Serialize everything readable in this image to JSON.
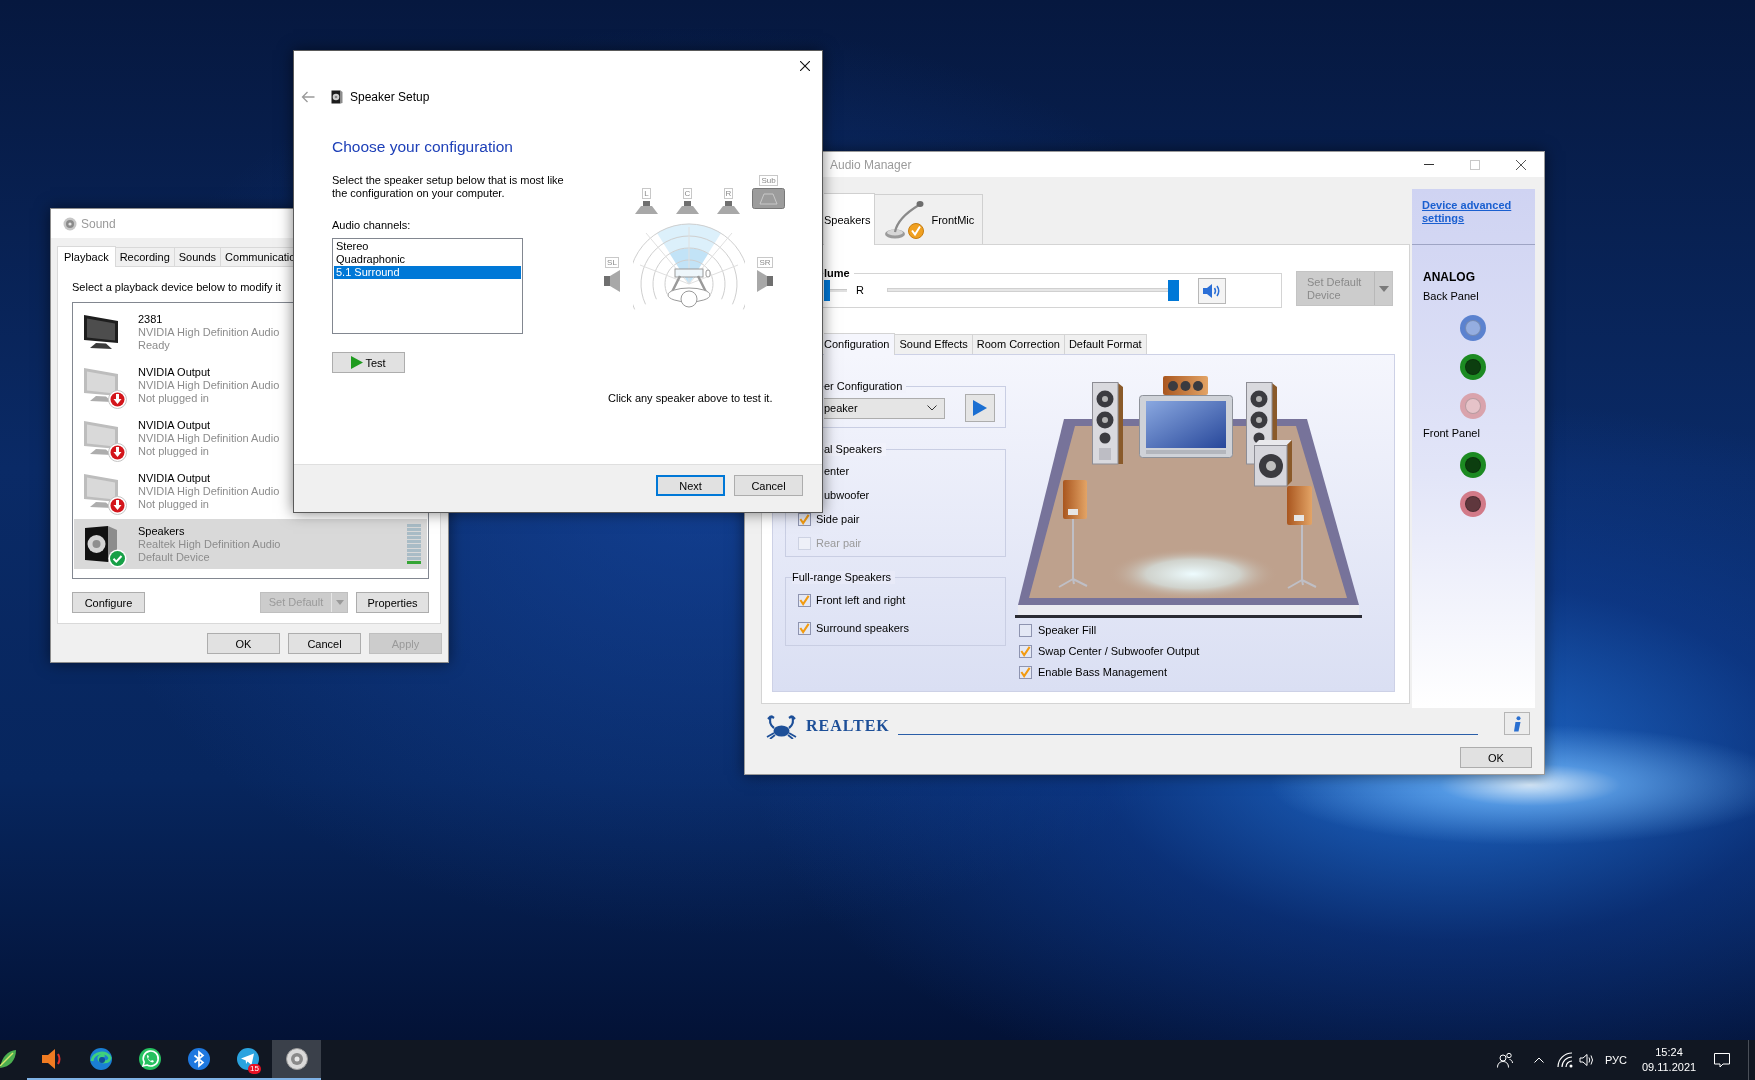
{
  "sound_window": {
    "title": "Sound",
    "tabs": [
      {
        "label": "Playback",
        "selected": true
      },
      {
        "label": "Recording",
        "selected": false
      },
      {
        "label": "Sounds",
        "selected": false
      },
      {
        "label": "Communicatio",
        "selected": false
      }
    ],
    "instruction": "Select a playback device below to modify it",
    "devices": [
      {
        "kind": "monitor",
        "name": "2381",
        "driver": "NVIDIA High Definition Audio",
        "status": "Ready",
        "unplugged": false,
        "default": false,
        "selected": false
      },
      {
        "kind": "monitor",
        "name": "NVIDIA Output",
        "driver": "NVIDIA High Definition Audio",
        "status": "Not plugged in",
        "unplugged": true,
        "default": false,
        "selected": false
      },
      {
        "kind": "monitor",
        "name": "NVIDIA Output",
        "driver": "NVIDIA High Definition Audio",
        "status": "Not plugged in",
        "unplugged": true,
        "default": false,
        "selected": false
      },
      {
        "kind": "monitor",
        "name": "NVIDIA Output",
        "driver": "NVIDIA High Definition Audio",
        "status": "Not plugged in",
        "unplugged": true,
        "default": false,
        "selected": false
      },
      {
        "kind": "speaker",
        "name": "Speakers",
        "driver": "Realtek High Definition Audio",
        "status": "Default Device",
        "unplugged": false,
        "default": true,
        "selected": true,
        "level": 0.1
      }
    ],
    "device_buttons": {
      "configure": {
        "label": "Configure",
        "disabled": false
      },
      "set_default": {
        "label": "Set Default",
        "disabled": true
      },
      "properties": {
        "label": "Properties",
        "disabled": false
      }
    },
    "footer_buttons": {
      "ok": {
        "label": "OK",
        "disabled": false
      },
      "cancel": {
        "label": "Cancel",
        "disabled": false
      },
      "apply": {
        "label": "Apply",
        "disabled": true
      }
    }
  },
  "speaker_setup": {
    "title": "Speaker Setup",
    "heading": "Choose your configuration",
    "description": "Select the speaker setup below that is most like the configuration on your computer.",
    "channels_label": "Audio channels:",
    "channels": [
      {
        "label": "Stereo",
        "selected": false
      },
      {
        "label": "Quadraphonic",
        "selected": false
      },
      {
        "label": "5.1 Surround",
        "selected": true
      }
    ],
    "test_button": "Test",
    "speakers": [
      {
        "kind": "left",
        "label": "L"
      },
      {
        "kind": "center",
        "label": "C"
      },
      {
        "kind": "right",
        "label": "R"
      },
      {
        "kind": "sub",
        "label": "Sub"
      },
      {
        "kind": "surround_left",
        "label": "SL"
      },
      {
        "kind": "surround_right",
        "label": "SR"
      }
    ],
    "hint": "Click any speaker above to test it.",
    "next_button": {
      "label": "Next",
      "default": true
    },
    "cancel_button": {
      "label": "Cancel",
      "default": false
    }
  },
  "audio_manager": {
    "title": "Audio Manager",
    "device_tabs": [
      {
        "kind": "speaker",
        "label": "Speakers",
        "selected": true
      },
      {
        "kind": "mic",
        "label": "FrontMic",
        "selected": false
      }
    ],
    "volume": {
      "label": "lume",
      "balance": {
        "label": "R",
        "level": 0
      },
      "main": {
        "level": 1
      }
    },
    "set_default_button": {
      "label": "Set Default Device",
      "disabled": true
    },
    "sub_tabs": [
      {
        "label": "Configuration",
        "selected": true
      },
      {
        "label": "Sound Effects",
        "selected": false
      },
      {
        "label": "Room Correction",
        "selected": false
      },
      {
        "label": "Default Format",
        "selected": false
      }
    ],
    "config_group": {
      "label": "er Configuration",
      "value": "peaker"
    },
    "optional_group": {
      "label": "al Speakers",
      "items": [
        {
          "kind": "cut",
          "label": "enter",
          "disabled": false
        },
        {
          "kind": "cut",
          "label": "ubwoofer",
          "disabled": false
        },
        {
          "kind": "checkbox",
          "label": "Side pair",
          "checked": true,
          "disabled": false
        },
        {
          "kind": "checkbox",
          "label": "Rear pair",
          "checked": false,
          "disabled": true
        }
      ]
    },
    "fullrange_group": {
      "label": "Full-range Speakers",
      "items": [
        {
          "label": "Front left and right",
          "checked": true
        },
        {
          "label": "Surround speakers",
          "checked": true
        }
      ]
    },
    "options": [
      {
        "label": "Speaker Fill",
        "checked": false
      },
      {
        "label": "Swap Center / Subwoofer Output",
        "checked": true
      },
      {
        "label": "Enable Bass Management",
        "checked": true
      }
    ],
    "sidebar": {
      "link": "Device advanced settings",
      "heading": "ANALOG",
      "panels": [
        {
          "label": "Back Panel",
          "jacks": [
            {
              "color": "#5b82cf",
              "plugged": false
            },
            {
              "color": "#1c8a22",
              "plugged": true
            },
            {
              "color": "#d9a3ac",
              "plugged": false
            }
          ]
        },
        {
          "label": "Front Panel",
          "jacks": [
            {
              "color": "#1c8a22",
              "plugged": true
            },
            {
              "color": "#d27a88",
              "plugged": true
            }
          ]
        }
      ]
    },
    "brand": "REALTEK",
    "ok_button": "OK"
  },
  "taskbar": {
    "apps": [
      {
        "kind": "leaf",
        "running": false,
        "active": false
      },
      {
        "kind": "speaker",
        "running": true,
        "active": false
      },
      {
        "kind": "swirl",
        "running": true,
        "active": false
      },
      {
        "kind": "chat",
        "running": true,
        "active": false
      },
      {
        "kind": "bluetooth",
        "running": true,
        "active": false
      },
      {
        "kind": "plane",
        "running": true,
        "active": false,
        "badge": "15"
      },
      {
        "kind": "speaker_disc",
        "running": true,
        "active": true
      }
    ],
    "language": "РУС",
    "time": "15:24",
    "date": "09.11.2021"
  }
}
